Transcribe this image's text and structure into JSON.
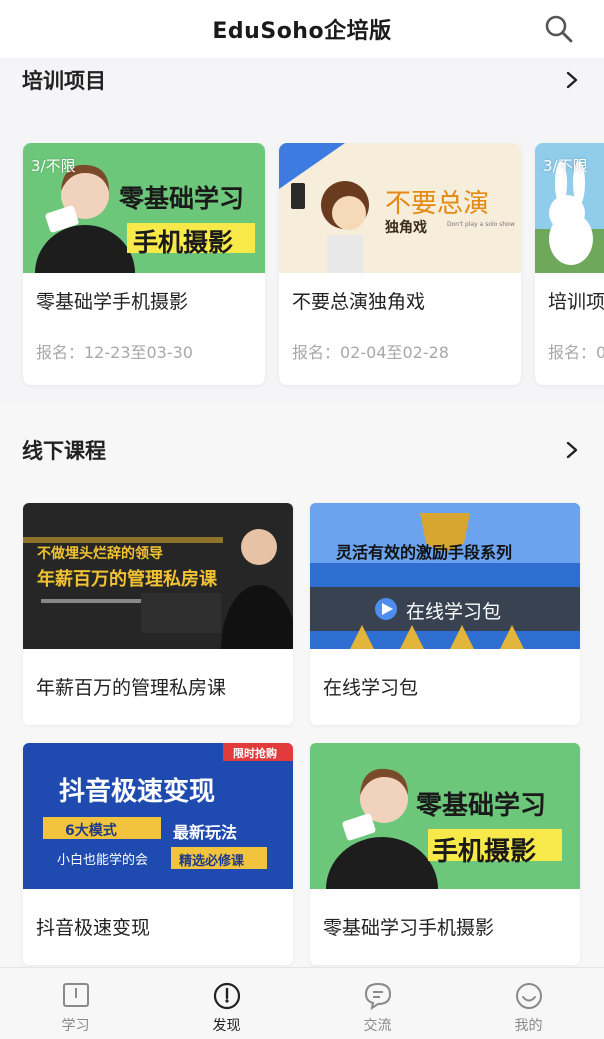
{
  "header": {
    "title": "EduSoho企培版"
  },
  "sections": [
    {
      "title": "培训项目",
      "cards": [
        {
          "title": "零基础学手机摄影",
          "meta": "报名：12-23至03-30",
          "badge": "3/不限",
          "thumb_lines": [
            "零基础学习",
            "手机摄影"
          ]
        },
        {
          "title": "不要总演独角戏",
          "meta": "报名：02-04至02-28",
          "badge": "",
          "thumb_lines": [
            "不要总演",
            "独角戏",
            "Don't play a solo show"
          ]
        },
        {
          "title": "培训项",
          "meta": "报名：0",
          "badge": "3/不限"
        }
      ]
    },
    {
      "title": "线下课程",
      "cards": [
        {
          "title": "年薪百万的管理私房课",
          "thumb_lines": [
            "不做埋头烂辞的领导",
            "年薪百万的管理私房课"
          ]
        },
        {
          "title": "在线学习包",
          "thumb_lines": [
            "灵活有效的激励手段系列",
            "在线学习包"
          ]
        },
        {
          "title": "抖音极速变现",
          "thumb_lines": [
            "限时抢购",
            "抖音极速变现",
            "6大模式",
            "最新玩法",
            "小白也能学的会",
            "精选必修课"
          ]
        },
        {
          "title": "零基础学习手机摄影",
          "thumb_lines": [
            "零基础学习",
            "手机摄影"
          ]
        }
      ]
    }
  ],
  "tabs": [
    {
      "label": "学习",
      "icon": "book-icon",
      "active": false
    },
    {
      "label": "发现",
      "icon": "compass-icon",
      "active": true
    },
    {
      "label": "交流",
      "icon": "chat-icon",
      "active": false
    },
    {
      "label": "我的",
      "icon": "smile-icon",
      "active": false
    }
  ],
  "colors": {
    "accent": "#222222",
    "muted": "#a8a8a8",
    "thumb_green": "#6cc77a",
    "thumb_beige": "#f6eddb",
    "thumb_dark": "#2b2b2b",
    "thumb_blue": "#2f6fd1"
  }
}
